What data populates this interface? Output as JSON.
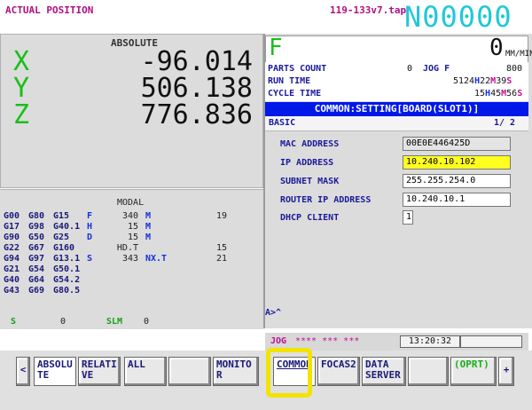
{
  "header": {
    "screen_title": "ACTUAL POSITION",
    "program_name": "119-133v7.tap",
    "program_number": "N00000"
  },
  "position": {
    "mode_title": "ABSOLUTE",
    "axes": [
      {
        "axis": "X",
        "value": "-96.014"
      },
      {
        "axis": "Y",
        "value": "506.138"
      },
      {
        "axis": "Z",
        "value": "776.836"
      }
    ]
  },
  "modal": {
    "title": "MODAL",
    "rows": [
      [
        "G00",
        "G80",
        "G15",
        "F",
        "340",
        "M",
        "19"
      ],
      [
        "G17",
        "G98",
        "G40.1",
        "H",
        "15",
        "M",
        ""
      ],
      [
        "G90",
        "G50",
        "G25",
        "D",
        "15",
        "M",
        ""
      ],
      [
        "G22",
        "G67",
        "G160",
        "",
        "HD.T",
        "",
        "15"
      ],
      [
        "G94",
        "G97",
        "G13.1",
        "S",
        "343",
        "NX.T",
        "21"
      ],
      [
        "G21",
        "G54",
        "G50.1",
        "",
        "",
        "",
        ""
      ],
      [
        "G40",
        "G64",
        "G54.2",
        "",
        "",
        "",
        ""
      ],
      [
        "G43",
        "G69",
        "G80.5",
        "",
        "",
        "",
        ""
      ]
    ],
    "footer": {
      "s_label": "S",
      "s_value": "0",
      "slm_label": "SLM",
      "slm_value": "0"
    }
  },
  "feed": {
    "label": "F",
    "value": "0",
    "unit": "MM/MIN"
  },
  "counters": {
    "parts_count_label": "PARTS COUNT",
    "parts_count_value": "0",
    "jog_label": "JOG F",
    "jog_value": "800",
    "run_time_label": "RUN TIME",
    "run_time": {
      "h": "5124",
      "m": "22",
      "s": "39"
    },
    "cycle_time_label": "CYCLE TIME",
    "cycle_time": {
      "h": "15",
      "m": "45",
      "s": "56"
    }
  },
  "setting": {
    "title": "COMMON:SETTING[BOARD(SLOT1)]",
    "section": "BASIC",
    "page": "1/ 2",
    "params": [
      {
        "label": "MAC ADDRESS",
        "value": "00E0E446425D"
      },
      {
        "label": "IP ADDRESS",
        "value": "10.240.10.102"
      },
      {
        "label": "SUBNET MASK",
        "value": "255.255.254.0"
      },
      {
        "label": "ROUTER IP ADDRESS",
        "value": "10.240.10.1"
      },
      {
        "label": "DHCP CLIENT",
        "value": "1"
      }
    ]
  },
  "prompt": "A>^",
  "status": {
    "mode": "JOG",
    "stars": "**** *** ***",
    "time": "13:20:32"
  },
  "softkeys": {
    "prev": "<",
    "absolute_1": "ABSOLU",
    "absolute_2": "TE",
    "relative_1": "RELATI",
    "relative_2": "VE",
    "all": "ALL",
    "monitor_1": "MONITO",
    "monitor_2": "R",
    "common": "COMMON",
    "focas2": "FOCAS2",
    "data_server_1": "DATA",
    "data_server_2": "SERVER",
    "oprt": "(OPRT)",
    "next": "+"
  },
  "colors": {
    "bluebar": "#0018e8",
    "highlight": "#f2e400",
    "ip_field": "#ffff20",
    "axis_green": "#18c018",
    "program_number": "#20c8d8"
  }
}
